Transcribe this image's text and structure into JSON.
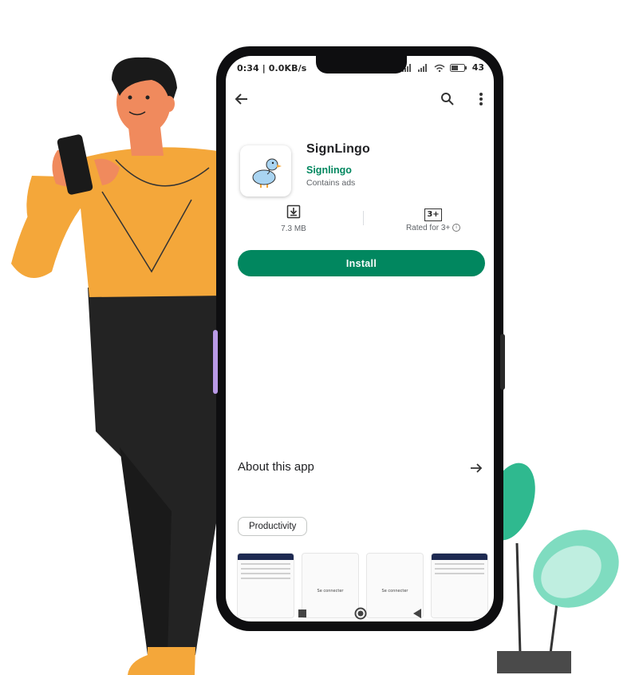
{
  "status_bar": {
    "time_speed": "0:34 | 0.0KB/s",
    "battery": "43"
  },
  "app": {
    "name": "SignLingo",
    "developer": "Signlingo",
    "ads_note": "Contains ads"
  },
  "stats": {
    "size": "7.3 MB",
    "rating_badge": "3+",
    "rating_label": "Rated for 3+"
  },
  "install_label": "Install",
  "about_title": "About this app",
  "category_chip": "Productivity",
  "screenshots": [
    {
      "caption": ""
    },
    {
      "caption": "Se connecter"
    },
    {
      "caption": "Se connecter"
    },
    {
      "caption": ""
    }
  ],
  "colors": {
    "accent": "#01875f",
    "shirt": "#f4a73a",
    "pants": "#222222",
    "plant": "#3cc39a"
  }
}
